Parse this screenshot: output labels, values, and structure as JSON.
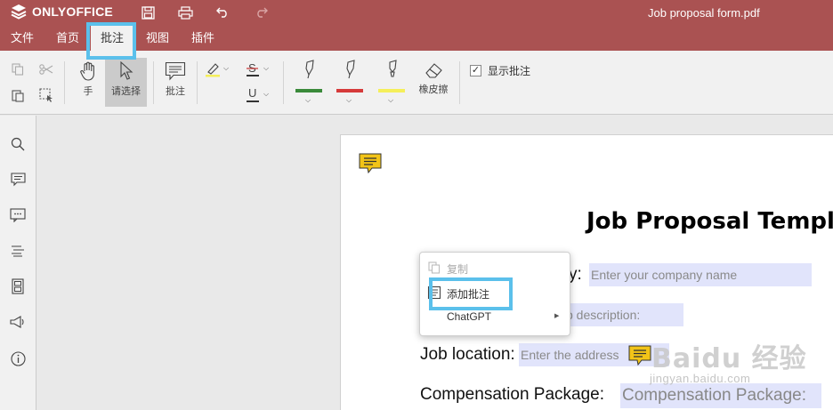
{
  "app": {
    "name": "ONLYOFFICE",
    "document_title": "Job proposal form.pdf"
  },
  "menu": {
    "tabs": [
      {
        "label": "文件"
      },
      {
        "label": "首页"
      },
      {
        "label": "批注"
      },
      {
        "label": "视图"
      },
      {
        "label": "插件"
      }
    ],
    "active_tab": "批注"
  },
  "toolbar": {
    "hand_label": "手",
    "select_label": "请选择",
    "comment_label": "批注",
    "eraser_label": "橡皮擦",
    "show_comments_label": "显示批注",
    "show_comments_checked": true,
    "pen_colors": [
      "#3a8a3a",
      "#d63a3a",
      "#f5ef5a"
    ],
    "highlight_color": "#f5ef5a"
  },
  "document": {
    "heading": "Job Proposal Templa",
    "company_label_suffix": "y:",
    "company_placeholder": "Enter your company name",
    "description_placeholder": "b description:",
    "location_label": "Job location:",
    "address_placeholder": "Enter the address",
    "compensation_label": "Compensation Package:",
    "compensation_field": "Compensation Package:"
  },
  "context_menu": {
    "items": [
      {
        "label": "复制",
        "enabled": false
      },
      {
        "label": "添加批注",
        "enabled": true
      },
      {
        "label": "ChatGPT",
        "enabled": true,
        "submenu": true
      }
    ]
  },
  "watermark": {
    "text": "Baidu 经验",
    "url_text": "jingyan.baidu.com"
  },
  "colors": {
    "titlebar": "#aa5252",
    "highlight_box": "#5bc0eb",
    "field_bg": "#e1e4fb",
    "comment_icon": "#f2c418"
  }
}
